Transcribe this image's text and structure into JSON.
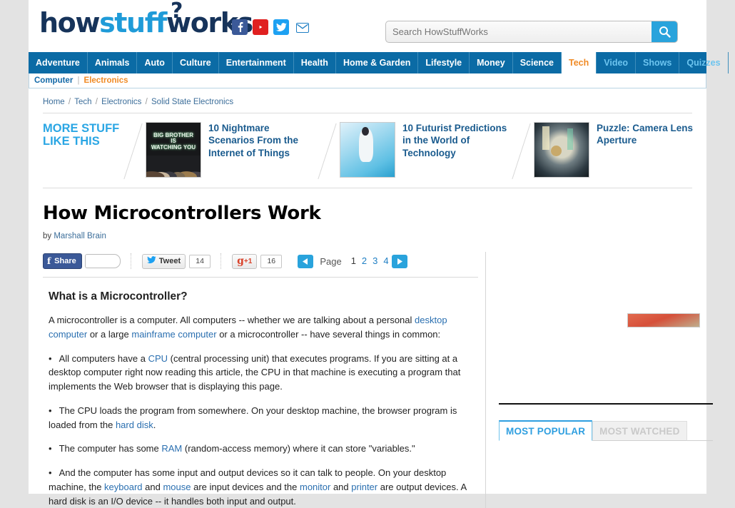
{
  "site": {
    "logo_how": "how",
    "logo_stuff": "stuff",
    "logo_works": "works",
    "logo_question": "?",
    "social": [
      {
        "name": "facebook-icon",
        "glyph": "f"
      },
      {
        "name": "youtube-icon",
        "glyph": "▶"
      },
      {
        "name": "twitter-icon",
        "glyph": "✉"
      },
      {
        "name": "email-icon",
        "glyph": "✉"
      }
    ]
  },
  "search": {
    "placeholder": "Search HowStuffWorks",
    "value": "",
    "button_icon": "search-icon"
  },
  "nav": {
    "items": [
      {
        "label": "Adventure",
        "state": "normal"
      },
      {
        "label": "Animals",
        "state": "normal"
      },
      {
        "label": "Auto",
        "state": "normal"
      },
      {
        "label": "Culture",
        "state": "normal"
      },
      {
        "label": "Entertainment",
        "state": "normal"
      },
      {
        "label": "Health",
        "state": "normal"
      },
      {
        "label": "Home & Garden",
        "state": "normal"
      },
      {
        "label": "Lifestyle",
        "state": "normal"
      },
      {
        "label": "Money",
        "state": "normal"
      },
      {
        "label": "Science",
        "state": "normal"
      },
      {
        "label": "Tech",
        "state": "active"
      },
      {
        "label": "Video",
        "state": "light"
      },
      {
        "label": "Shows",
        "state": "light"
      },
      {
        "label": "Quizzes",
        "state": "light"
      }
    ]
  },
  "subnav": {
    "items": [
      {
        "label": "Computer",
        "state": "normal"
      },
      {
        "label": "Electronics",
        "state": "active"
      }
    ]
  },
  "breadcrumb": {
    "items": [
      "Home",
      "Tech",
      "Electronics",
      "Solid State Electronics"
    ]
  },
  "more_stuff": {
    "title_line1": "MORE STUFF",
    "title_line2": "LIKE THIS",
    "items": [
      {
        "caption": "10 Nightmare Scenarios From the Internet of Things",
        "thumb": "big-brother-theater",
        "thumb_text": "BIG BROTHER\nIS\nWATCHING YOU"
      },
      {
        "caption": "10 Futurist Predictions in the World of Technology",
        "thumb": "futurist-woman-touchscreen"
      },
      {
        "caption": "Puzzle: Camera Lens Aperture",
        "thumb": "camera-lens-aperture"
      }
    ]
  },
  "article": {
    "title": "How Microcontrollers Work",
    "by_prefix": "by ",
    "author": "Marshall Brain",
    "section_heading": "What is a Microcontroller?",
    "intro": {
      "p1": "A microcontroller is a computer. All computers -- whether we are talking about a personal ",
      "link1": "desktop computer",
      "p2": " or a large ",
      "link2": "mainframe computer",
      "p3": " or a microcontroller -- have several things in common:"
    },
    "bullets": [
      {
        "parts": [
          {
            "t": "All computers have a ",
            "link": false
          },
          {
            "t": "CPU",
            "link": true
          },
          {
            "t": " (central processing unit) that executes programs. If you are sitting at a desktop computer right now reading this article, the CPU in that machine is executing a program that implements the Web browser that is displaying this page.",
            "link": false
          }
        ]
      },
      {
        "parts": [
          {
            "t": "The CPU loads the program from somewhere. On your desktop machine, the browser program is loaded from the ",
            "link": false
          },
          {
            "t": "hard disk",
            "link": true
          },
          {
            "t": ".",
            "link": false
          }
        ]
      },
      {
        "parts": [
          {
            "t": "The computer has some ",
            "link": false
          },
          {
            "t": "RAM",
            "link": true
          },
          {
            "t": " (random-access memory) where it can store \"variables.\"",
            "link": false
          }
        ]
      },
      {
        "parts": [
          {
            "t": "And the computer has some input and output devices so it can talk to people. On your desktop machine, the ",
            "link": false
          },
          {
            "t": "keyboard",
            "link": true
          },
          {
            "t": " and ",
            "link": false
          },
          {
            "t": "mouse",
            "link": true
          },
          {
            "t": " are input devices and the ",
            "link": false
          },
          {
            "t": "monitor",
            "link": true
          },
          {
            "t": " and ",
            "link": false
          },
          {
            "t": "printer",
            "link": true
          },
          {
            "t": " are output devices. A hard disk is an I/O device -- it handles both input and output.",
            "link": false
          }
        ]
      }
    ]
  },
  "share": {
    "facebook_label": "Share",
    "facebook_icon": "f",
    "tweet_label": "Tweet",
    "tweet_count": "14",
    "gplus_g": "g",
    "gplus_plus": "+1",
    "gplus_count": "16"
  },
  "pager": {
    "prev_icon": "◀",
    "next_icon": "▶",
    "label": "Page",
    "pages": [
      "1",
      "2",
      "3",
      "4"
    ],
    "current": "1"
  },
  "sidebar": {
    "tabs": [
      {
        "label": "MOST POPULAR",
        "state": "active"
      },
      {
        "label": "MOST WATCHED",
        "state": "inactive"
      }
    ]
  },
  "colors": {
    "nav_blue": "#0b6ba5",
    "accent_orange": "#f08a24",
    "link_blue": "#2a6fb0",
    "bright_blue": "#2aa6e4",
    "page_bg": "#e3e3e3"
  }
}
